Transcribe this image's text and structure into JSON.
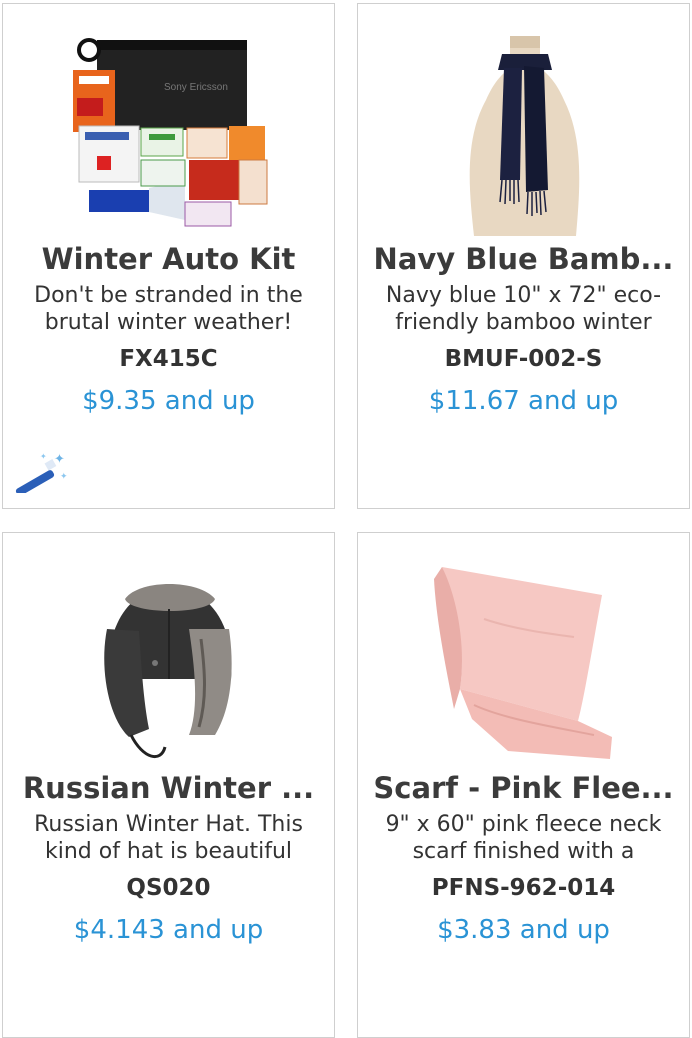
{
  "products": [
    {
      "title": "Winter Auto Kit",
      "description": "Don't be stranded in the brutal winter weather!",
      "sku": "FX415C",
      "price": "$9.35 and up",
      "image": "winter-auto-kit-image",
      "bag_label": "Sony Ericsson"
    },
    {
      "title": "Navy Blue Bamb...",
      "description": "Navy blue 10\" x 72\" eco-friendly bamboo winter",
      "sku": "BMUF-002-S",
      "price": "$11.67 and up",
      "image": "navy-scarf-image"
    },
    {
      "title": "Russian Winter ...",
      "description": "Russian Winter Hat. This kind of hat is beautiful",
      "sku": "QS020",
      "price": "$4.143 and up",
      "image": "russian-hat-image"
    },
    {
      "title": "Scarf - Pink Flee...",
      "description": "9\" x 60\" pink fleece neck scarf finished with a",
      "sku": "PFNS-962-014",
      "price": "$3.83 and up",
      "image": "pink-fleece-scarf-image"
    }
  ],
  "icons": {
    "magic_wand": "magic-wand-icon"
  },
  "colors": {
    "price": "#2a93d5",
    "title": "#3b3b3b",
    "border": "#cfcfcf"
  }
}
